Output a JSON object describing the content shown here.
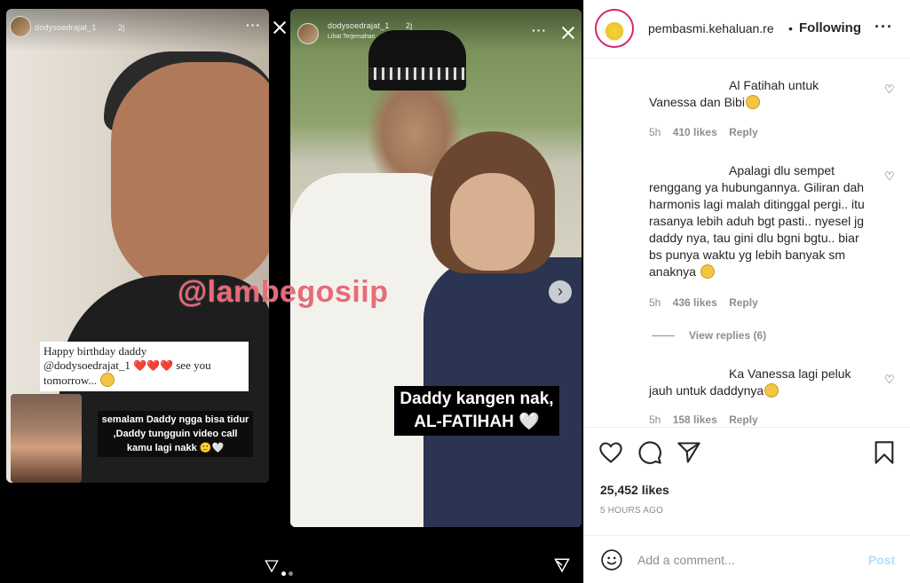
{
  "media": {
    "story_left": {
      "username": "dodysoedrajat_1",
      "time": "2j",
      "watermark": "@lambegosiip",
      "caption_line1": "Happy birthday daddy",
      "caption_line2": "@dodysoedrajat_1",
      "caption_hearts": "❤️❤️❤️",
      "caption_line2_tail": "see you",
      "caption_line3": "tomorrow...",
      "sticker_text": "semalam Daddy ngga bisa tidur ,Daddy tungguin video call kamu lagi nakk 🙂🤍"
    },
    "story_right": {
      "username": "dodysoedrajat_1",
      "time": "2j",
      "translate_label": "Lihat Terjemahan",
      "sticker_line1": "Daddy kangen nak,",
      "sticker_line2": "AL-FATIHAH 🤍"
    }
  },
  "post": {
    "username": "pembasmi.kehaluan.re",
    "bullet": "•",
    "follow_status": "Following",
    "more_icon": "more-options-icon",
    "comments": [
      {
        "text": "Al Fatihah untuk Vanessa dan Bibi",
        "emoji": "sad-face",
        "time": "5h",
        "likes": "410 likes",
        "reply": "Reply"
      },
      {
        "text": "Apalagi dlu sempet renggang ya hubungannya. Giliran dah harmonis lagi malah ditinggal pergi.. itu rasanya lebih aduh bgt pasti.. nyesel jg daddy nya, tau gini dlu bgni bgtu.. biar bs punya waktu yg lebih banyak sm anaknya",
        "emoji": "sad-face",
        "time": "5h",
        "likes": "436 likes",
        "reply": "Reply",
        "view_replies": "View replies (6)"
      },
      {
        "text": "Ka Vanessa lagi peluk jauh untuk daddynya",
        "emoji": "halo-smile-face",
        "time": "5h",
        "likes": "158 likes",
        "reply": "Reply"
      }
    ],
    "likes_count": "25,452 likes",
    "time_ago": "5 HOURS AGO",
    "add_comment_placeholder": "Add a comment...",
    "post_button": "Post",
    "colors": {
      "accent_post": "#b2dffc",
      "meta_gray": "#8e8e8e",
      "text": "#262626"
    }
  }
}
